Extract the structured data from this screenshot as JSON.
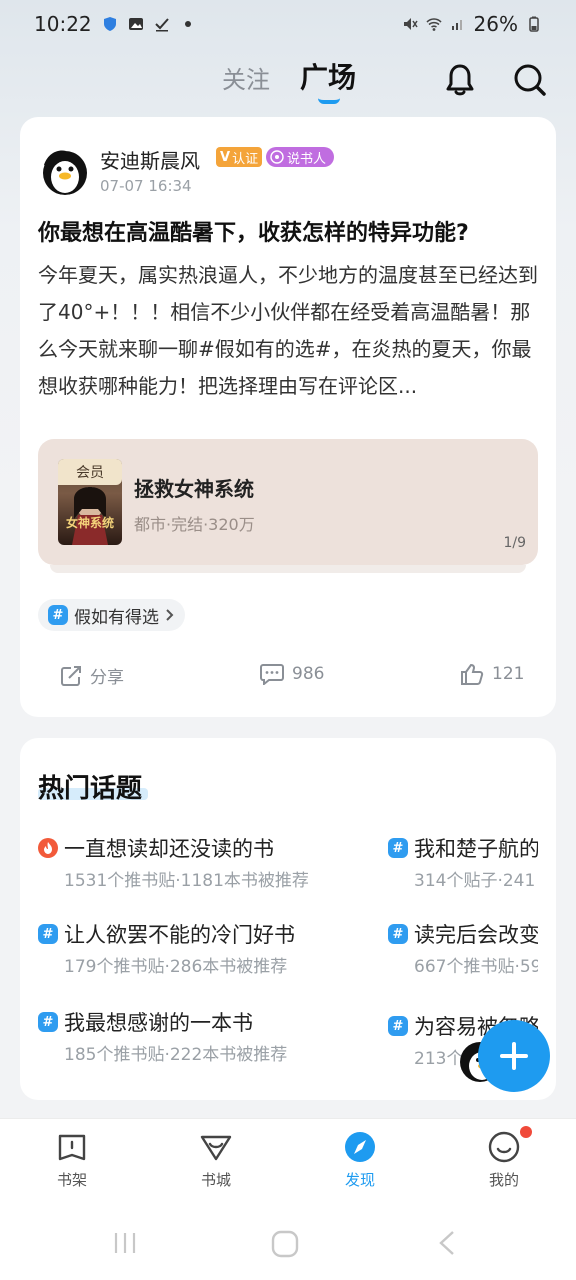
{
  "status_bar": {
    "time": "10:22",
    "battery": "26%"
  },
  "header": {
    "tab_follow": "关注",
    "tab_square": "广场"
  },
  "post": {
    "author": "安迪斯晨风",
    "badge_verified": "认证",
    "badge_storyteller": "说书人",
    "time": "07-07 16:34",
    "title": "你最想在高温酷暑下，收获怎样的特异功能?",
    "body": "今年夏天，属实热浪逼人，不少地方的温度甚至已经达到了40°+！！！相信不少小伙伴都在经受着高温酷暑！那么今天就来聊一聊#假如有的选#，在炎热的夏天，你最想收获哪种能力！把选择理由写在评论区...",
    "book": {
      "member_label": "会员",
      "cover_title": "女神系统",
      "title": "拯救女神系统",
      "meta": "都市·完结·320万",
      "page": "1/9"
    },
    "topic_tag": "假如有得选",
    "share_label": "分享",
    "comment_count": "986",
    "like_count": "121"
  },
  "hot_topics": {
    "title": "热门话题",
    "left": [
      {
        "name": "一直想读却还没读的书",
        "stats": "1531个推书贴·1181本书被推荐",
        "icon": "flame-icon"
      },
      {
        "name": "让人欲罢不能的冷门好书",
        "stats": "179个推书贴·286本书被推荐",
        "icon": "hash-icon"
      },
      {
        "name": "我最想感谢的一本书",
        "stats": "185个推书贴·222本书被推荐",
        "icon": "hash-icon"
      }
    ],
    "right": [
      {
        "name": "我和楚子航的",
        "stats": "314个贴子·241",
        "icon": "hash-icon"
      },
      {
        "name": "读完后会改变",
        "stats": "667个推书贴·59",
        "icon": "hash-icon"
      },
      {
        "name": "为容易被忽略",
        "stats": "213个",
        "icon": "hash-icon"
      }
    ]
  },
  "bottom_nav": {
    "shelf": "书架",
    "store": "书城",
    "discover": "发现",
    "mine": "我的"
  },
  "colors": {
    "accent": "#1e9bf0",
    "hot": "#f25a3a"
  }
}
